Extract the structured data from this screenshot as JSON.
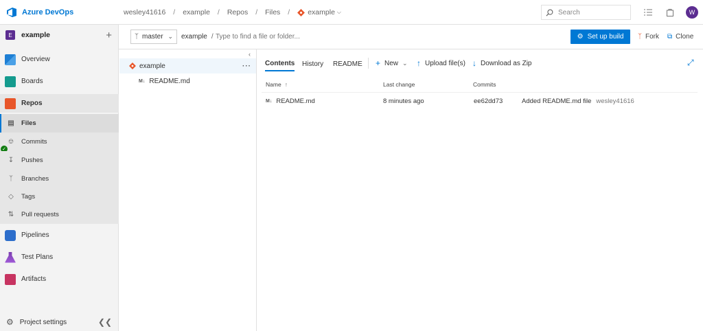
{
  "brand": {
    "name": "Azure DevOps",
    "color": "#0078d4"
  },
  "breadcrumb": [
    "wesley41616",
    "example",
    "Repos",
    "Files",
    "example"
  ],
  "search": {
    "placeholder": "Search"
  },
  "user": {
    "avatar_initial": "W",
    "avatar_color": "#5c2d91"
  },
  "project": {
    "tile": "E",
    "name": "example"
  },
  "nav": {
    "items": [
      {
        "label": "Overview",
        "icon": "overview-icon"
      },
      {
        "label": "Boards",
        "icon": "boards-icon"
      },
      {
        "label": "Repos",
        "icon": "repos-icon"
      },
      {
        "label": "Pipelines",
        "icon": "pipelines-icon"
      },
      {
        "label": "Test Plans",
        "icon": "test-plans-icon"
      },
      {
        "label": "Artifacts",
        "icon": "artifacts-icon"
      }
    ],
    "repo_sub": [
      {
        "label": "Files",
        "icon": "files-icon",
        "selected": true
      },
      {
        "label": "Commits",
        "icon": "commits-icon"
      },
      {
        "label": "Pushes",
        "icon": "pushes-icon"
      },
      {
        "label": "Branches",
        "icon": "branches-icon"
      },
      {
        "label": "Tags",
        "icon": "tags-icon"
      },
      {
        "label": "Pull requests",
        "icon": "pull-requests-icon"
      }
    ],
    "settings": "Project settings"
  },
  "toolbar": {
    "branch": "master",
    "repo": "example",
    "path_sep": "/",
    "find_placeholder": "Type to find a file or folder...",
    "setup_build": "Set up build",
    "fork": "Fork",
    "clone": "Clone"
  },
  "tree": {
    "root": "example",
    "children": [
      "README.md"
    ]
  },
  "tabs": [
    "Contents",
    "History",
    "README"
  ],
  "actions": {
    "new": "New",
    "upload": "Upload file(s)",
    "download": "Download as Zip"
  },
  "table": {
    "columns": [
      "Name",
      "Last change",
      "Commits"
    ],
    "sort_arrow": "↑",
    "rows": [
      {
        "name": "README.md",
        "last_change": "8 minutes ago",
        "commit": "ee62dd73",
        "message": "Added README.md file",
        "author": "wesley41616"
      }
    ]
  }
}
